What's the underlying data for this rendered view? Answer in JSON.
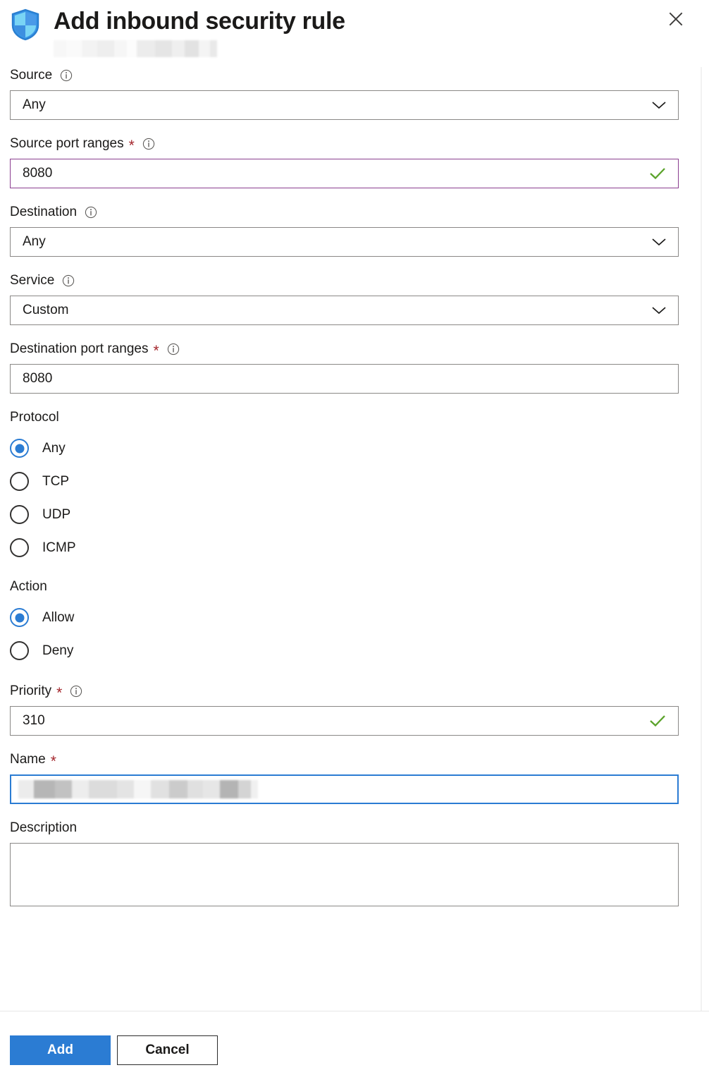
{
  "header": {
    "icon": "shield-icon",
    "title": "Add inbound security rule",
    "subtitle_redacted": true,
    "close_label": "Close",
    "close_icon": "close-icon"
  },
  "form": {
    "fields": [
      {
        "key": "source",
        "label": "Source",
        "required": false,
        "info": true,
        "control": "dropdown",
        "value": "Any",
        "state": "normal"
      },
      {
        "key": "source_port_ranges",
        "label": "Source port ranges",
        "required": true,
        "info": true,
        "control": "text",
        "value": "8080",
        "state": "visited",
        "valid": true
      },
      {
        "key": "destination",
        "label": "Destination",
        "required": false,
        "info": true,
        "control": "dropdown",
        "value": "Any",
        "state": "normal"
      },
      {
        "key": "service",
        "label": "Service",
        "required": false,
        "info": true,
        "control": "dropdown",
        "value": "Custom",
        "state": "normal"
      },
      {
        "key": "destination_port_ranges",
        "label": "Destination port ranges",
        "required": true,
        "info": true,
        "control": "text",
        "value": "8080",
        "state": "normal",
        "valid": false
      }
    ],
    "protocol": {
      "label": "Protocol",
      "selected": "Any",
      "options": [
        "Any",
        "TCP",
        "UDP",
        "ICMP"
      ]
    },
    "action": {
      "label": "Action",
      "selected": "Allow",
      "options": [
        "Allow",
        "Deny"
      ]
    },
    "priority": {
      "label": "Priority",
      "required": true,
      "info": true,
      "value": "310",
      "valid": true
    },
    "name": {
      "label": "Name",
      "required": true,
      "info": false,
      "value_redacted": true,
      "state": "focused"
    },
    "description": {
      "label": "Description",
      "required": false,
      "value": "",
      "placeholder": ""
    }
  },
  "footer": {
    "add_label": "Add",
    "cancel_label": "Cancel"
  },
  "colors": {
    "accent_blue": "#2b7cd3",
    "required_red": "#a4262c",
    "valid_green": "#5ba32b",
    "visited_purple": "#8a3d8f",
    "border_gray": "#8a8886",
    "text": "#1b1a19"
  }
}
